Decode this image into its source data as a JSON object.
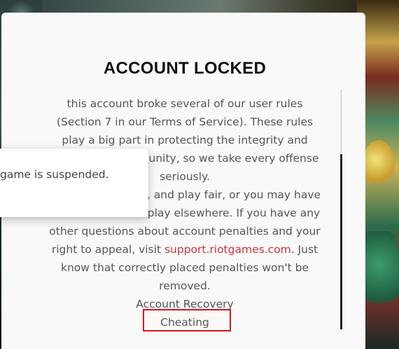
{
  "modal": {
    "title": "ACCOUNT LOCKED",
    "body_lines": [
      "this account broke several of our user rules",
      "(Section 7 in our Terms of Service). These rules",
      "play a big part in protecting the integrity and",
      "unity, so we take every offense",
      "seriously.",
      ", and play fair, or you may have",
      "play elsewhere. If you have any",
      "other questions about account penalties and your"
    ],
    "appeal_prefix": "right to appeal, visit ",
    "appeal_link": "support.riotgames.com",
    "appeal_suffix": ". Just",
    "tail_lines": [
      "know that correctly placed penalties won't be",
      "removed."
    ],
    "recovery_label": "Account Recovery",
    "reason_label": "Cheating"
  },
  "toast": {
    "message": "game is suspended."
  },
  "colors": {
    "link": "#c8333e",
    "highlight_border": "#d8141e",
    "modal_bg": "#f9f9f9"
  }
}
